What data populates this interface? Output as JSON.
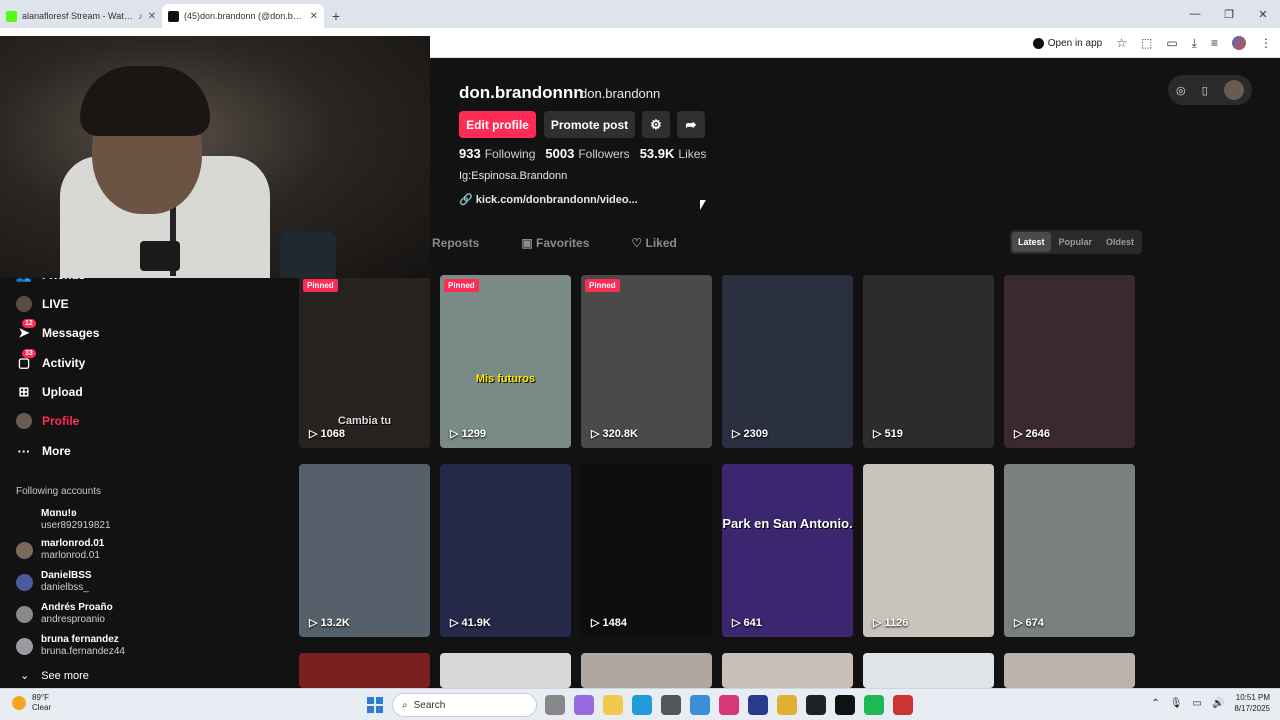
{
  "browser": {
    "tabs": [
      {
        "title": "alanafloresf Stream - Watch",
        "favicon_color": "#53fc18",
        "active": false
      },
      {
        "title": "(45)don.brandonn (@don.bran",
        "favicon_color": "#111111",
        "active": true
      }
    ],
    "toolbar": {
      "open_in_app": "Open in app"
    }
  },
  "profile": {
    "username": "don.brandonnn",
    "nickname": "don.brandonn",
    "edit_label": "Edit profile",
    "promote_label": "Promote post",
    "following_count": "933",
    "following_label": "Following",
    "followers_count": "5003",
    "followers_label": "Followers",
    "likes_count": "53.9K",
    "likes_label": "Likes",
    "bio": "Ig:Espinosa.Brandonn",
    "link": "kick.com/donbrandonn/video..."
  },
  "tabs": {
    "reposts": "Reposts",
    "favorites": "Favorites",
    "liked": "Liked"
  },
  "sort": {
    "latest": "Latest",
    "popular": "Popular",
    "oldest": "Oldest"
  },
  "nav": {
    "friends": "Friends",
    "live": "LIVE",
    "messages": "Messages",
    "messages_badge": "12",
    "activity": "Activity",
    "activity_badge": "33",
    "upload": "Upload",
    "profile": "Profile",
    "more": "More"
  },
  "following_accounts": {
    "title": "Following accounts",
    "items": [
      {
        "name": "Mɑnu!ʚ",
        "handle": "user892919821"
      },
      {
        "name": "marlonrod.01",
        "handle": "marlonrod.01"
      },
      {
        "name": "DanielBSS",
        "handle": "danielbss_"
      },
      {
        "name": "Andrés Proaño",
        "handle": "andresproanio"
      },
      {
        "name": "bruna fernandez",
        "handle": "bruna.fernandez44"
      }
    ],
    "see_more": "See more"
  },
  "videos": [
    {
      "views": "1068",
      "pinned": "Pinned",
      "caption": "Cambia tu",
      "bg": "#262220"
    },
    {
      "views": "1299",
      "pinned": "Pinned",
      "caption": "Mis futuros",
      "bg": "#7a8a86"
    },
    {
      "views": "320.8K",
      "pinned": "Pinned",
      "caption": "",
      "bg": "#4a4a48"
    },
    {
      "views": "2309",
      "pinned": "",
      "caption": "",
      "bg": "#2a3040"
    },
    {
      "views": "519",
      "pinned": "",
      "caption": "",
      "bg": "#2c2c2c"
    },
    {
      "views": "2646",
      "pinned": "",
      "caption": "",
      "bg": "#3a2a30"
    },
    {
      "views": "13.2K",
      "pinned": "",
      "caption": "",
      "bg": "#56606a"
    },
    {
      "views": "41.9K",
      "pinned": "",
      "caption": "",
      "bg": "#252848"
    },
    {
      "views": "1484",
      "pinned": "",
      "caption": "",
      "bg": "#0e0e10"
    },
    {
      "views": "641",
      "pinned": "",
      "caption": "Park en San Antonio.",
      "bg": "#3c2670"
    },
    {
      "views": "1126",
      "pinned": "",
      "caption": "",
      "bg": "#c8c4bc"
    },
    {
      "views": "674",
      "pinned": "",
      "caption": "",
      "bg": "#7c807c"
    }
  ],
  "row3_colors": [
    "#7a2020",
    "#d8d8d8",
    "#b0a8a0",
    "#c8c0b8",
    "#e0e4e8",
    "#bcb4ac"
  ],
  "taskbar": {
    "temp": "89°F",
    "condition": "Clear",
    "search": "Search",
    "time": "10:51 PM",
    "date": "8/17/2025"
  }
}
